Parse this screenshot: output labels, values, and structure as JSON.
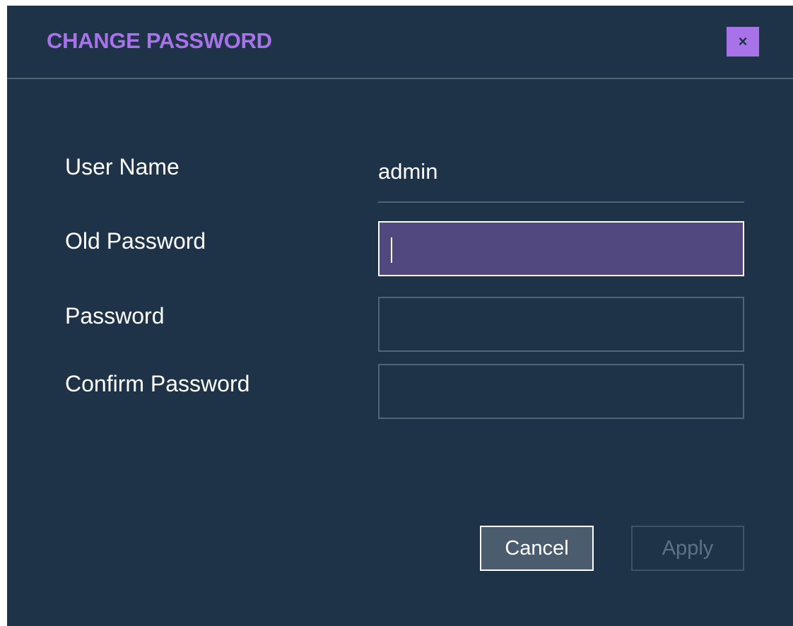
{
  "dialog": {
    "title": "CHANGE PASSWORD",
    "close_label": "×",
    "close_icon": "close-icon"
  },
  "form": {
    "user_name_label": "User Name",
    "user_name_value": "admin",
    "old_password_label": "Old Password",
    "old_password_value": "",
    "password_label": "Password",
    "password_value": "",
    "confirm_password_label": "Confirm Password",
    "confirm_password_value": ""
  },
  "actions": {
    "cancel_label": "Cancel",
    "apply_label": "Apply"
  },
  "colors": {
    "background": "#1e3347",
    "accent": "#a872e8",
    "focused_field": "#524880",
    "divider": "#4f6475"
  }
}
